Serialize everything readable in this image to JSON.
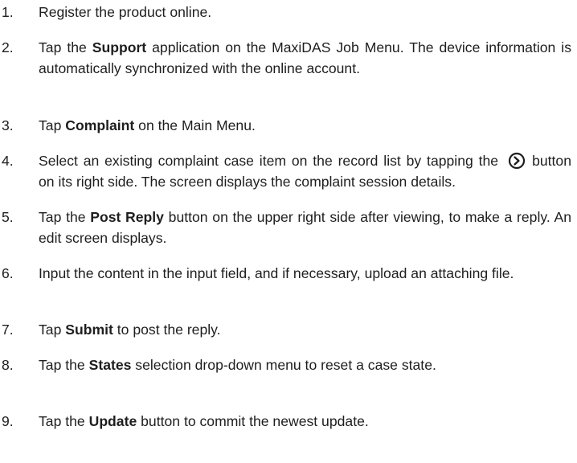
{
  "steps": [
    {
      "n": "1.",
      "parts": [
        "Register the product online."
      ]
    },
    {
      "n": "2.",
      "parts": [
        "Tap the ",
        "Support",
        " application on the MaxiDAS Job Menu. The device information is automatically synchronized with the online account."
      ]
    },
    {
      "n": "3.",
      "parts": [
        "Tap ",
        "Complaint",
        " on the Main Menu."
      ]
    },
    {
      "n": "4.",
      "parts": [
        "Select an existing complaint case item on the record list by tapping the",
        "button on its right side. The screen displays the complaint session details."
      ]
    },
    {
      "n": "5.",
      "parts": [
        "Tap the ",
        "Post Reply",
        " button on the upper right side after viewing, to make a reply. An edit screen displays."
      ]
    },
    {
      "n": "6.",
      "parts": [
        "Input the content in the input field, and if necessary, upload an attaching file."
      ]
    },
    {
      "n": "7.",
      "parts": [
        "Tap ",
        "Submit",
        " to post the reply."
      ]
    },
    {
      "n": "8.",
      "parts": [
        "Tap the ",
        "States",
        " selection drop-down menu to reset a case state."
      ]
    },
    {
      "n": "9.",
      "parts": [
        "Tap the ",
        "Update",
        " button to commit the newest update."
      ]
    }
  ],
  "icons": {
    "step4_button": "circle-chevron-right-icon"
  }
}
